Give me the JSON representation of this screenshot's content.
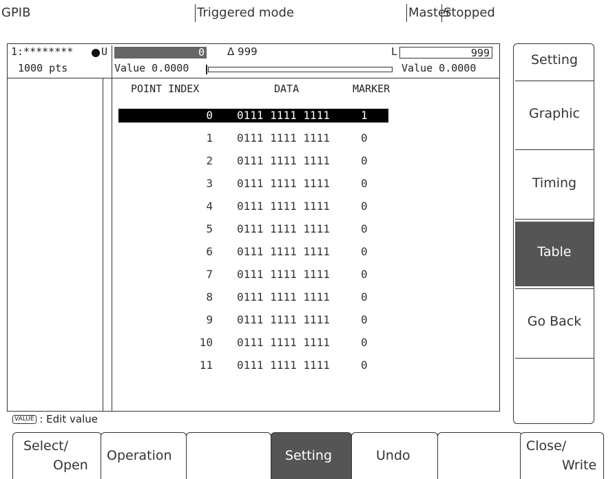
{
  "topbar": {
    "interface": "GPIB",
    "mode": "Triggered mode",
    "role": "Master",
    "state": "Stopped"
  },
  "header": {
    "channel_label": "1:********",
    "points": "1000 pts",
    "u_label": "U",
    "u_value": "0",
    "delta": "Δ 999",
    "l_label": "L",
    "l_value": "999",
    "value_left": "Value 0.0000",
    "value_right": "Value 0.0000"
  },
  "table": {
    "columns": [
      "POINT INDEX",
      "DATA",
      "MARKER"
    ],
    "rows": [
      {
        "index": "0",
        "data": "0111 1111 1111",
        "marker": "1"
      },
      {
        "index": "1",
        "data": "0111 1111 1111",
        "marker": "0"
      },
      {
        "index": "2",
        "data": "0111 1111 1111",
        "marker": "0"
      },
      {
        "index": "3",
        "data": "0111 1111 1111",
        "marker": "0"
      },
      {
        "index": "4",
        "data": "0111 1111 1111",
        "marker": "0"
      },
      {
        "index": "5",
        "data": "0111 1111 1111",
        "marker": "0"
      },
      {
        "index": "6",
        "data": "0111 1111 1111",
        "marker": "0"
      },
      {
        "index": "7",
        "data": "0111 1111 1111",
        "marker": "0"
      },
      {
        "index": "8",
        "data": "0111 1111 1111",
        "marker": "0"
      },
      {
        "index": "9",
        "data": "0111 1111 1111",
        "marker": "0"
      },
      {
        "index": "10",
        "data": "0111 1111 1111",
        "marker": "0"
      },
      {
        "index": "11",
        "data": "0111 1111 1111",
        "marker": "0"
      }
    ]
  },
  "status": {
    "key": "VALUE",
    "text": ": Edit value"
  },
  "side_menu": [
    "Setting",
    "Graphic",
    "Timing",
    "Table",
    "Go Back"
  ],
  "bottom_menu": {
    "select_open": [
      "Select/",
      "Open"
    ],
    "operation": "Operation",
    "setting": "Setting",
    "undo": "Undo",
    "close_write": [
      "Close/",
      "Write"
    ]
  }
}
